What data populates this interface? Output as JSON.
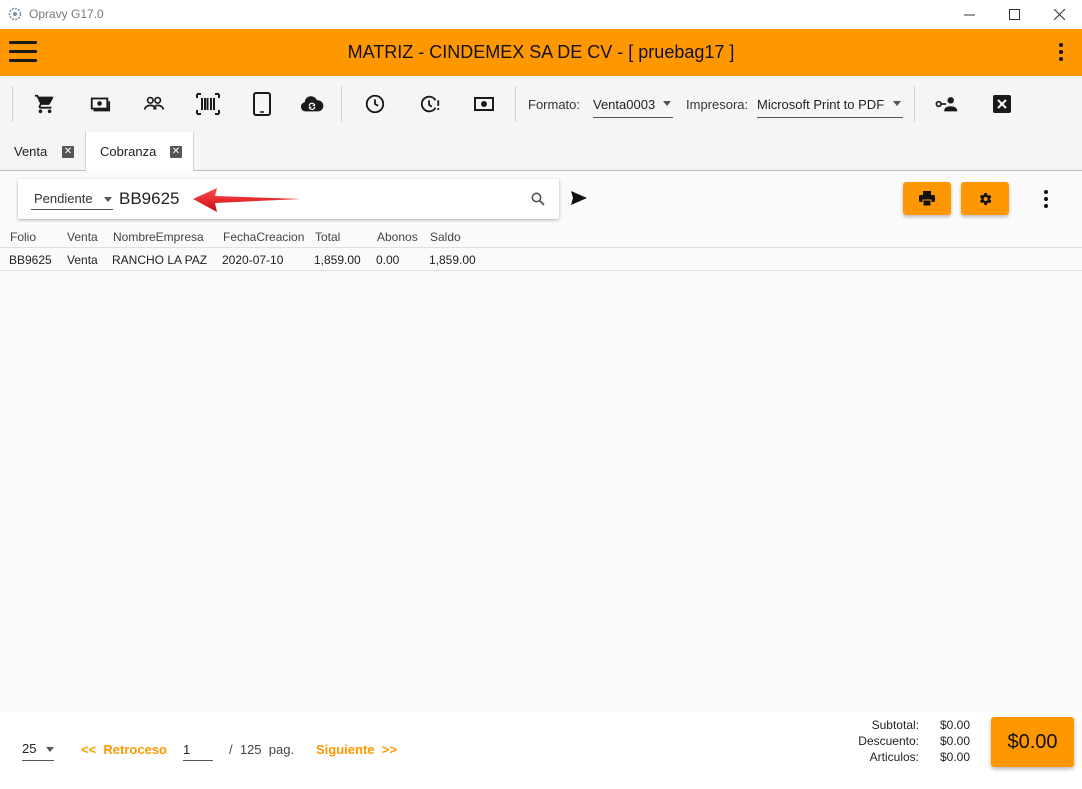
{
  "window": {
    "title": "Opravy G17.0"
  },
  "app_bar": {
    "title": "MATRIZ - CINDEMEX SA DE CV - [ pruebag17 ]"
  },
  "toolbar": {
    "formato_label": "Formato:",
    "formato_value": "Venta0003",
    "impresora_label": "Impresora:",
    "impresora_value": "Microsoft Print to PDF"
  },
  "tabs": [
    {
      "label": "Venta"
    },
    {
      "label": "Cobranza"
    }
  ],
  "search": {
    "status_value": "Pendiente",
    "query": "BB9625"
  },
  "table": {
    "headers": [
      "Folio",
      "Venta",
      "NombreEmpresa",
      "FechaCreacion",
      "Total",
      "Abonos",
      "Saldo"
    ],
    "rows": [
      [
        "BB9625",
        "Venta",
        "RANCHO LA PAZ",
        "2020-07-10",
        "1,859.00",
        "0.00",
        "1,859.00"
      ]
    ]
  },
  "pagination": {
    "page_size": "25",
    "prev_label": "<<  Retroceso",
    "current_page": "1",
    "total_pages": "/  125  pag.",
    "next_label": "Siguiente  >>"
  },
  "summary": {
    "subtotal_label": "Subtotal:",
    "subtotal_value": "$0.00",
    "descuento_label": "Descuento:",
    "descuento_value": "$0.00",
    "articulos_label": "Articulos:",
    "articulos_value": "$0.00",
    "total": "$0.00"
  },
  "colors": {
    "accent": "#ff9800",
    "annotation_arrow": "#e8171b"
  }
}
